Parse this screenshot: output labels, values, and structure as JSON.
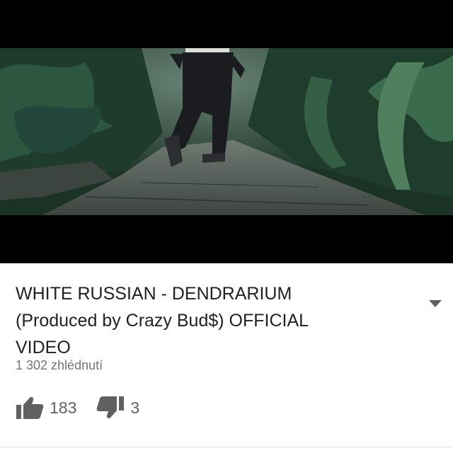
{
  "video": {
    "thumbnail_icon": "video-frame-jungle-path"
  },
  "info": {
    "title_lines": [
      "WHITE RUSSIAN - DENDRARIUM",
      "(Produced by Crazy Bud$) OFFICIAL",
      "VIDEO"
    ],
    "views": "1 302 zhlédnutí",
    "likes": "183",
    "dislikes": "3",
    "expand_icon": "chevron-down-icon",
    "like_icon": "thumbs-up-icon",
    "dislike_icon": "thumbs-down-icon"
  },
  "colors": {
    "title": "#212121",
    "views": "#757575",
    "icons": "#606060",
    "video_bg": "#000000"
  }
}
